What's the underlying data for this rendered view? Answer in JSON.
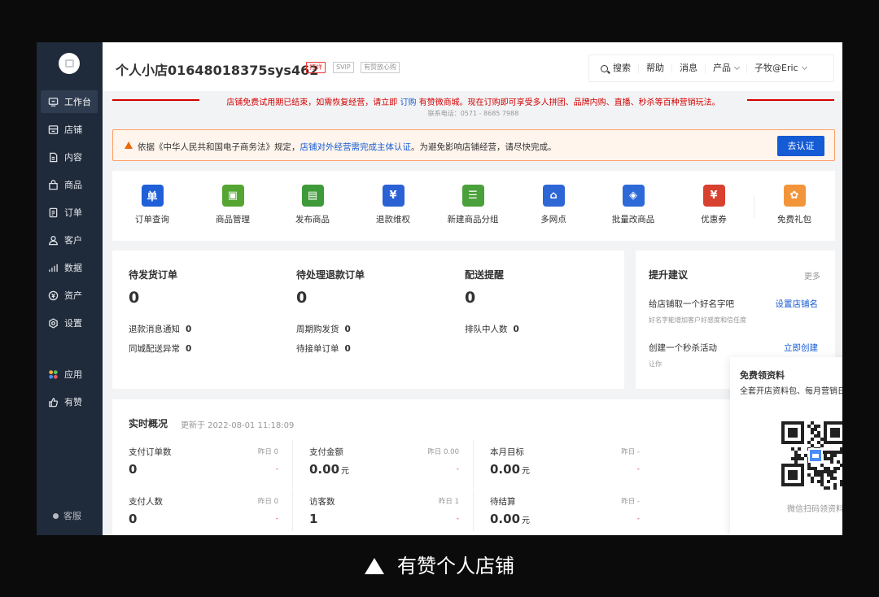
{
  "sidebar": {
    "items": [
      {
        "label": "工作台",
        "icon": "workbench-icon"
      },
      {
        "label": "店铺",
        "icon": "store-icon"
      },
      {
        "label": "内容",
        "icon": "content-icon"
      },
      {
        "label": "商品",
        "icon": "goods-icon"
      },
      {
        "label": "订单",
        "icon": "order-icon"
      },
      {
        "label": "客户",
        "icon": "customer-icon"
      },
      {
        "label": "数据",
        "icon": "data-icon"
      },
      {
        "label": "资产",
        "icon": "asset-icon"
      },
      {
        "label": "设置",
        "icon": "settings-icon"
      },
      {
        "label": "应用",
        "icon": "apps-icon"
      },
      {
        "label": "有赞",
        "icon": "youzan-icon"
      }
    ],
    "kefu": "客服"
  },
  "header": {
    "shop_name": "个人小店01648018375sys462",
    "tags": [
      "打烊",
      "SVIP",
      "有赞放心购"
    ],
    "tools": [
      "搜索",
      "帮助",
      "消息",
      "产品",
      "子牧@Eric"
    ]
  },
  "notice": {
    "text_before": "店铺免费试用期已结束，如需恢复经营，请立即 ",
    "link": "订购",
    "text_after": " 有赞微商城。现在订购即可享受多人拼团、品牌内购、直播、秒杀等百种营销玩法。",
    "phone": "联系电话：0571 - 8685 7988"
  },
  "warning": {
    "text_before": "依据《中华人民共和国电子商务法》规定，",
    "link": "店铺对外经营需完成主体认证",
    "text_after": "。为避免影响店铺经营，请尽快完成。",
    "button": "去认证"
  },
  "quick_entries": [
    {
      "label": "订单查询",
      "glyph": "单",
      "color": "#1f5fd8"
    },
    {
      "label": "商品管理",
      "glyph": "▣",
      "color": "#55a532"
    },
    {
      "label": "发布商品",
      "glyph": "▤",
      "color": "#3f9a3a"
    },
    {
      "label": "退款维权",
      "glyph": "¥",
      "color": "#2a62d6"
    },
    {
      "label": "新建商品分组",
      "glyph": "☰",
      "color": "#4aa03a"
    },
    {
      "label": "多网点",
      "glyph": "⌂",
      "color": "#2f66d6"
    },
    {
      "label": "批量改商品",
      "glyph": "◈",
      "color": "#2d6ad8"
    },
    {
      "label": "优惠券",
      "glyph": "¥",
      "color": "#d8402f"
    },
    {
      "label": "免费礼包",
      "glyph": "✿",
      "color": "#f2953a"
    }
  ],
  "stats": [
    {
      "title": "待发货订单",
      "value": "0",
      "subs": [
        {
          "label": "退款消息通知",
          "value": "0"
        },
        {
          "label": "同城配送异常",
          "value": "0"
        }
      ]
    },
    {
      "title": "待处理退款订单",
      "value": "0",
      "subs": [
        {
          "label": "周期购发货",
          "value": "0"
        },
        {
          "label": "待接单订单",
          "value": "0"
        }
      ]
    },
    {
      "title": "配送提醒",
      "value": "0",
      "subs": [
        {
          "label": "排队中人数",
          "value": "0"
        }
      ]
    }
  ],
  "suggestions": {
    "title": "提升建议",
    "more": "更多",
    "items": [
      {
        "text": "给店铺取一个好名字吧",
        "link": "设置店铺名",
        "sub": "好名字能增加客户好感度和信任度"
      },
      {
        "text": "创建一个秒杀活动",
        "link": "立即创建",
        "sub": "让你"
      }
    ]
  },
  "realtime": {
    "title": "实时概况",
    "updated": "更新于 2022-08-01 11:18:09",
    "cells": [
      {
        "label": "支付订单数",
        "yesterday": "昨日 0",
        "value": "0",
        "unit": "",
        "delta": "-"
      },
      {
        "label": "支付金额",
        "yesterday": "昨日 0.00",
        "value": "0.00",
        "unit": "元",
        "delta": "-"
      },
      {
        "label": "本月目标",
        "yesterday": "昨日 -",
        "value": "0.00",
        "unit": "元",
        "delta": "-"
      },
      {
        "label": "支付人数",
        "yesterday": "昨日 0",
        "value": "0",
        "unit": "",
        "delta": "-"
      },
      {
        "label": "访客数",
        "yesterday": "昨日 1",
        "value": "1",
        "unit": "",
        "delta": "-"
      },
      {
        "label": "待结算",
        "yesterday": "昨日 -",
        "value": "0.00",
        "unit": "元",
        "delta": "-"
      }
    ]
  },
  "popup": {
    "title": "免费领资料",
    "subtitle": "全套开店资料包、每月营销日历",
    "caption": "微信扫码领资料"
  },
  "caption": "有赞个人店铺",
  "colors": {
    "primary": "#155bd4",
    "danger": "#d40000",
    "sidebar": "#1f2a3a"
  }
}
